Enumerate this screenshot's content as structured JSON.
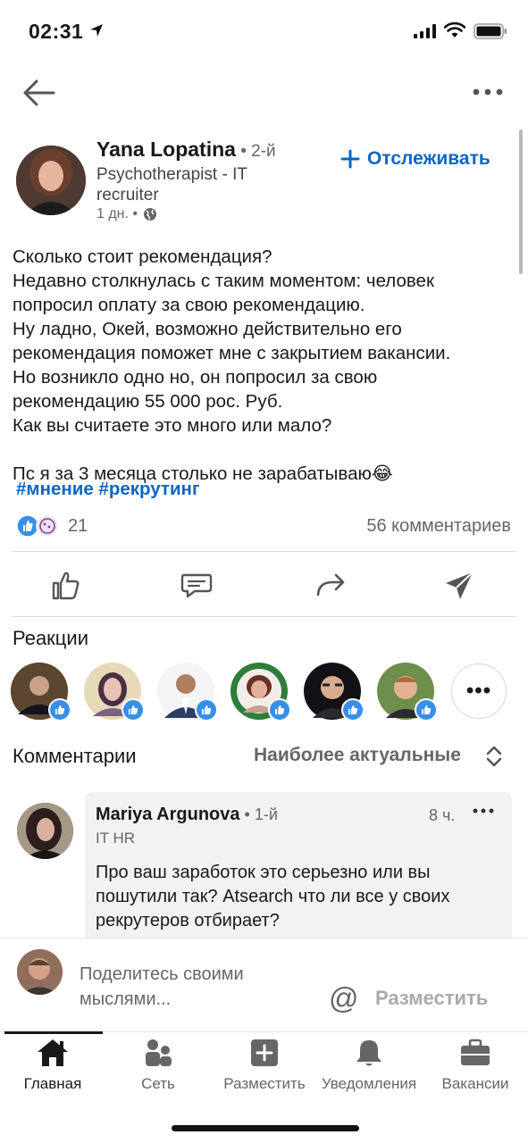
{
  "status_bar": {
    "time": "02:31"
  },
  "post": {
    "author": {
      "name": "Yana Lopatina",
      "degree": " • 2-й",
      "headline": "Psychotherapist - IT recruiter",
      "time": "1 дн. •"
    },
    "follow_label": "Отслеживать",
    "body_lines": [
      "Сколько стоит рекомендация?",
      "Недавно столкнулась с таким моментом: человек",
      "попросил оплату за свою рекомендацию.",
      "Ну ладно, Окей, возможно действительно его",
      "рекомендация поможет мне с закрытием вакансии.",
      "Но возникло одно но, он попросил за свою",
      "рекомендацию 55 000 рос. Руб.",
      "Как вы считаете это много или мало?",
      "",
      "Пс я за 3 месяца столько не зарабатываю😂"
    ],
    "hashtags": "#мнение #рекрутинг",
    "reaction_count": "21",
    "comments_count": "56 комментариев"
  },
  "reactions": {
    "title": "Реакции",
    "more_label": "•••"
  },
  "comments": {
    "title": "Комментарии",
    "sort_label": "Наиболее актуальные",
    "items": [
      {
        "name": "Mariya Argunova",
        "degree": " • 1-й",
        "time": "8 ч.",
        "headline": "IT HR",
        "text": "Про ваш заработок это серьезно или вы пошутили так? Atsearch что ли все у своих рекрутеров отбирает?"
      }
    ]
  },
  "composer": {
    "placeholder": "Поделитесь своими мыслями...",
    "mention": "@",
    "post_label": "Разместить"
  },
  "tabs": [
    {
      "label": "Главная",
      "icon": "home-icon"
    },
    {
      "label": "Сеть",
      "icon": "network-icon"
    },
    {
      "label": "Разместить",
      "icon": "add-post-icon"
    },
    {
      "label": "Уведомления",
      "icon": "bell-icon"
    },
    {
      "label": "Вакансии",
      "icon": "briefcase-icon"
    }
  ],
  "colors": {
    "brand": "#0a66c2",
    "like_badge": "#378fe9",
    "text": "#191919",
    "muted": "#666666"
  }
}
